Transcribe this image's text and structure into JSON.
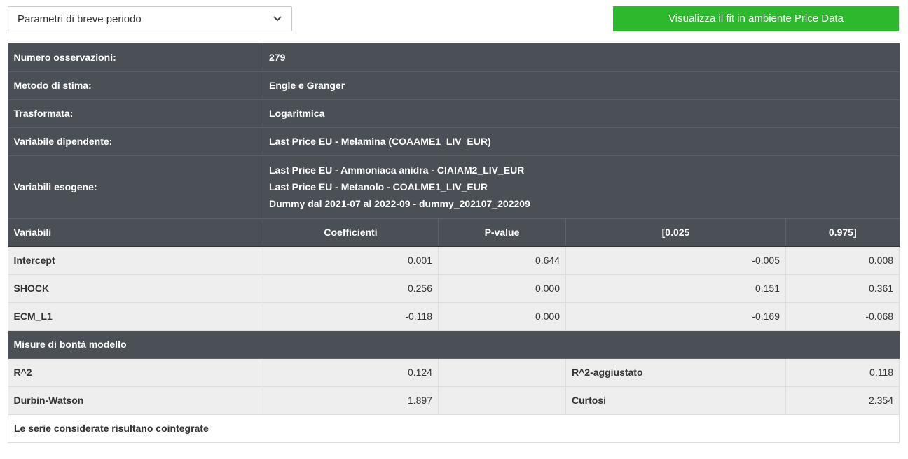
{
  "controls": {
    "period_select": "Parametri di breve periodo",
    "view_fit_button": "Visualizza il fit in ambiente Price Data"
  },
  "info": {
    "n_obs_label": "Numero osservazioni:",
    "n_obs_value": "279",
    "method_label": "Metodo di stima:",
    "method_value": "Engle e Granger",
    "transform_label": "Trasformata:",
    "transform_value": "Logaritmica",
    "dependent_label": "Variabile dipendente:",
    "dependent_value": "Last Price EU - Melamina (COAAME1_LIV_EUR)",
    "exog_label": "Variabili esogene:",
    "exog_values": [
      "Last Price EU - Ammoniaca anidra - CIAIAM2_LIV_EUR",
      "Last Price EU - Metanolo - COALME1_LIV_EUR",
      "Dummy dal 2021-07 al 2022-09 - dummy_202107_202209"
    ]
  },
  "coef_table": {
    "headers": [
      "Variabili",
      "Coefficienti",
      "P-value",
      "[0.025",
      "0.975]"
    ],
    "rows": [
      [
        "Intercept",
        "0.001",
        "0.644",
        "-0.005",
        "0.008"
      ],
      [
        "SHOCK",
        "0.256",
        "0.000",
        "0.151",
        "0.361"
      ],
      [
        "ECM_L1",
        "-0.118",
        "0.000",
        "-0.169",
        "-0.068"
      ]
    ]
  },
  "fit": {
    "section_label": "Misure di bontà modello",
    "rows": [
      [
        "R^2",
        "0.124",
        "R^2-aggiustato",
        "0.118"
      ],
      [
        "Durbin-Watson",
        "1.897",
        "Curtosi",
        "2.354"
      ]
    ],
    "conclusion": "Le serie considerate risultano cointegrate"
  },
  "colors": {
    "button_green": "#2db82d",
    "dark_row": "#4b4f56",
    "light_row": "#eeeeee"
  }
}
